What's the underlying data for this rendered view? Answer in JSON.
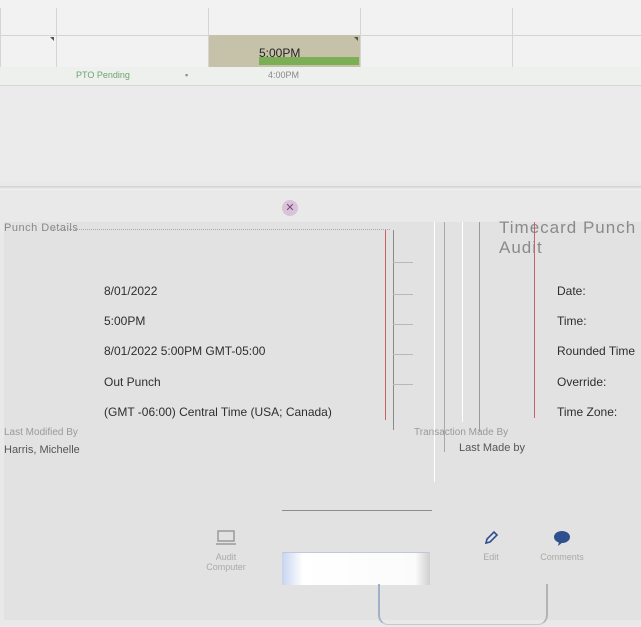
{
  "grid": {
    "selected_cell_value": "5:00PM",
    "row2_left": "PTO Pending",
    "row2_mid": "4:00PM"
  },
  "panel": {
    "left_header": "Punch Details",
    "right_header": "Timecard Punch Audit",
    "values": [
      "8/01/2022",
      "5:00PM",
      "8/01/2022 5:00PM GMT-05:00",
      "Out Punch",
      "(GMT -06:00) Central Time (USA; Canada)"
    ],
    "labels": [
      "Date:",
      "Time:",
      "Rounded Time",
      "Override:",
      "Time Zone:"
    ],
    "notes_left": "Last Modified By",
    "notes_right": "Transaction Made By",
    "who_left": "Harris, Michelle",
    "who_right": "Last Made by"
  },
  "actions": {
    "audit_label": "Audit Computer",
    "edit_label": "Edit",
    "comments_label": "Comments"
  },
  "colors": {
    "selected_cell": "#c6c1a9",
    "green_bar": "#7cae55",
    "red_line": "#c96363",
    "icon_blue": "#2f4f8f"
  }
}
